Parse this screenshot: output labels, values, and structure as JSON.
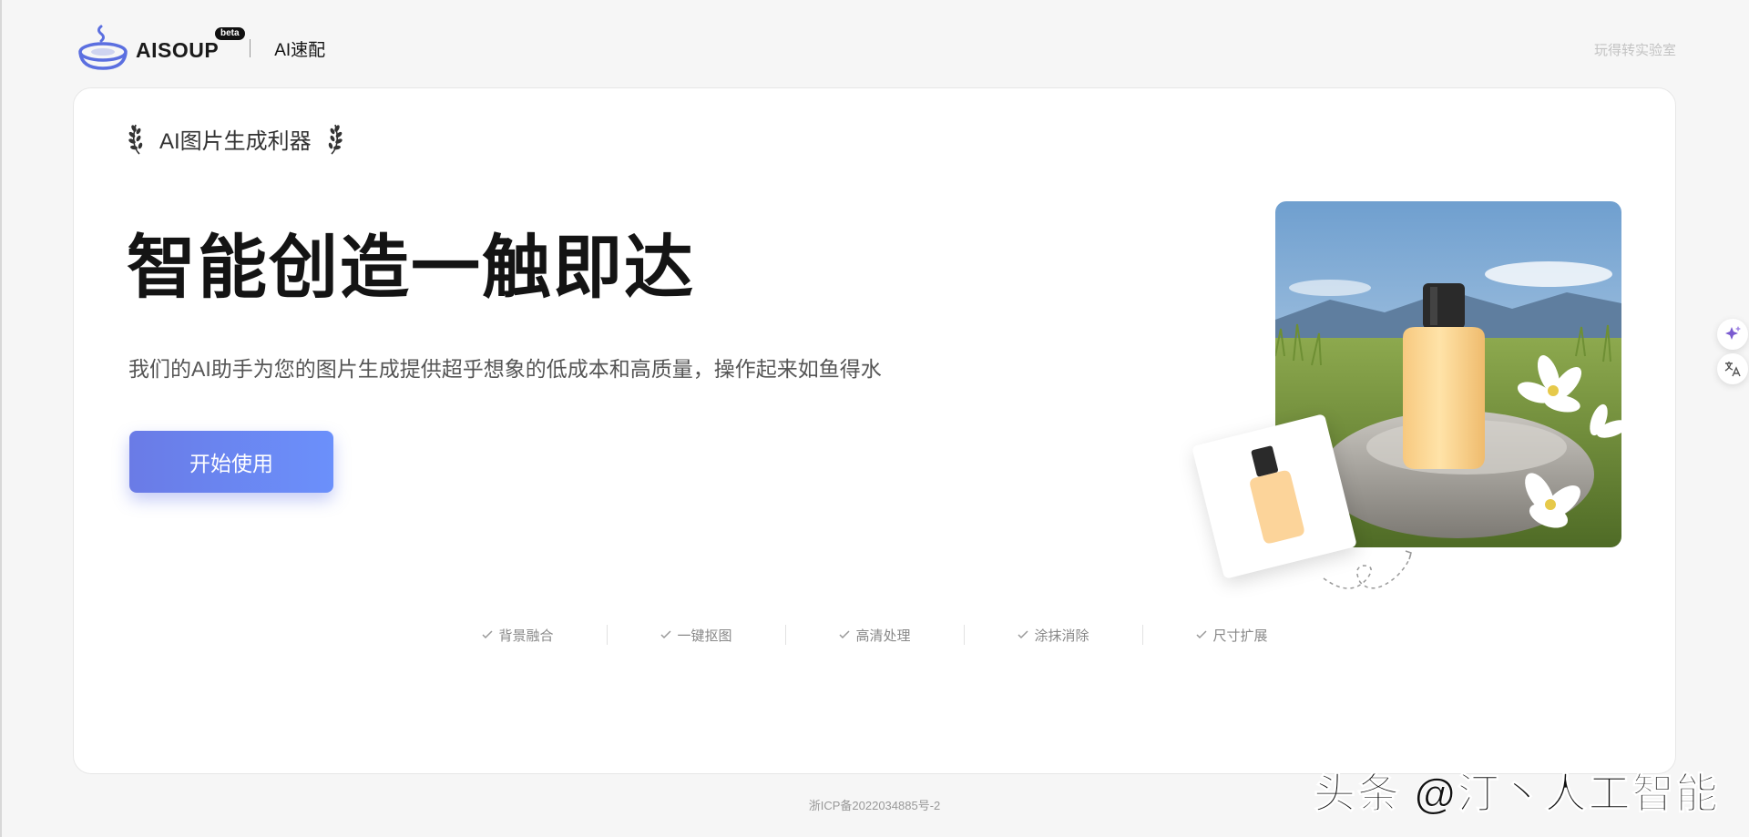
{
  "header": {
    "brand_name": "AISOUP",
    "beta_label": "beta",
    "subtitle": "AI速配",
    "right_link": "玩得转实验室"
  },
  "hero": {
    "tagline": "AI图片生成利器",
    "title": "智能创造一触即达",
    "description": "我们的AI助手为您的图片生成提供超乎想象的低成本和高质量，操作起来如鱼得水",
    "start_button": "开始使用"
  },
  "features": [
    {
      "label": "背景融合"
    },
    {
      "label": "一键抠图"
    },
    {
      "label": "高清处理"
    },
    {
      "label": "涂抹消除"
    },
    {
      "label": "尺寸扩展"
    }
  ],
  "footer": {
    "icp": "浙ICP备2022034885号-2"
  },
  "watermark": "头条 @汀丶人工智能",
  "side_buttons": {
    "magic_icon": "sparkle-icon",
    "translate_icon": "translate-icon"
  },
  "colors": {
    "accent_start": "#6a7be6",
    "accent_end": "#6b90fb",
    "logo_blue": "#5b6fe0"
  }
}
